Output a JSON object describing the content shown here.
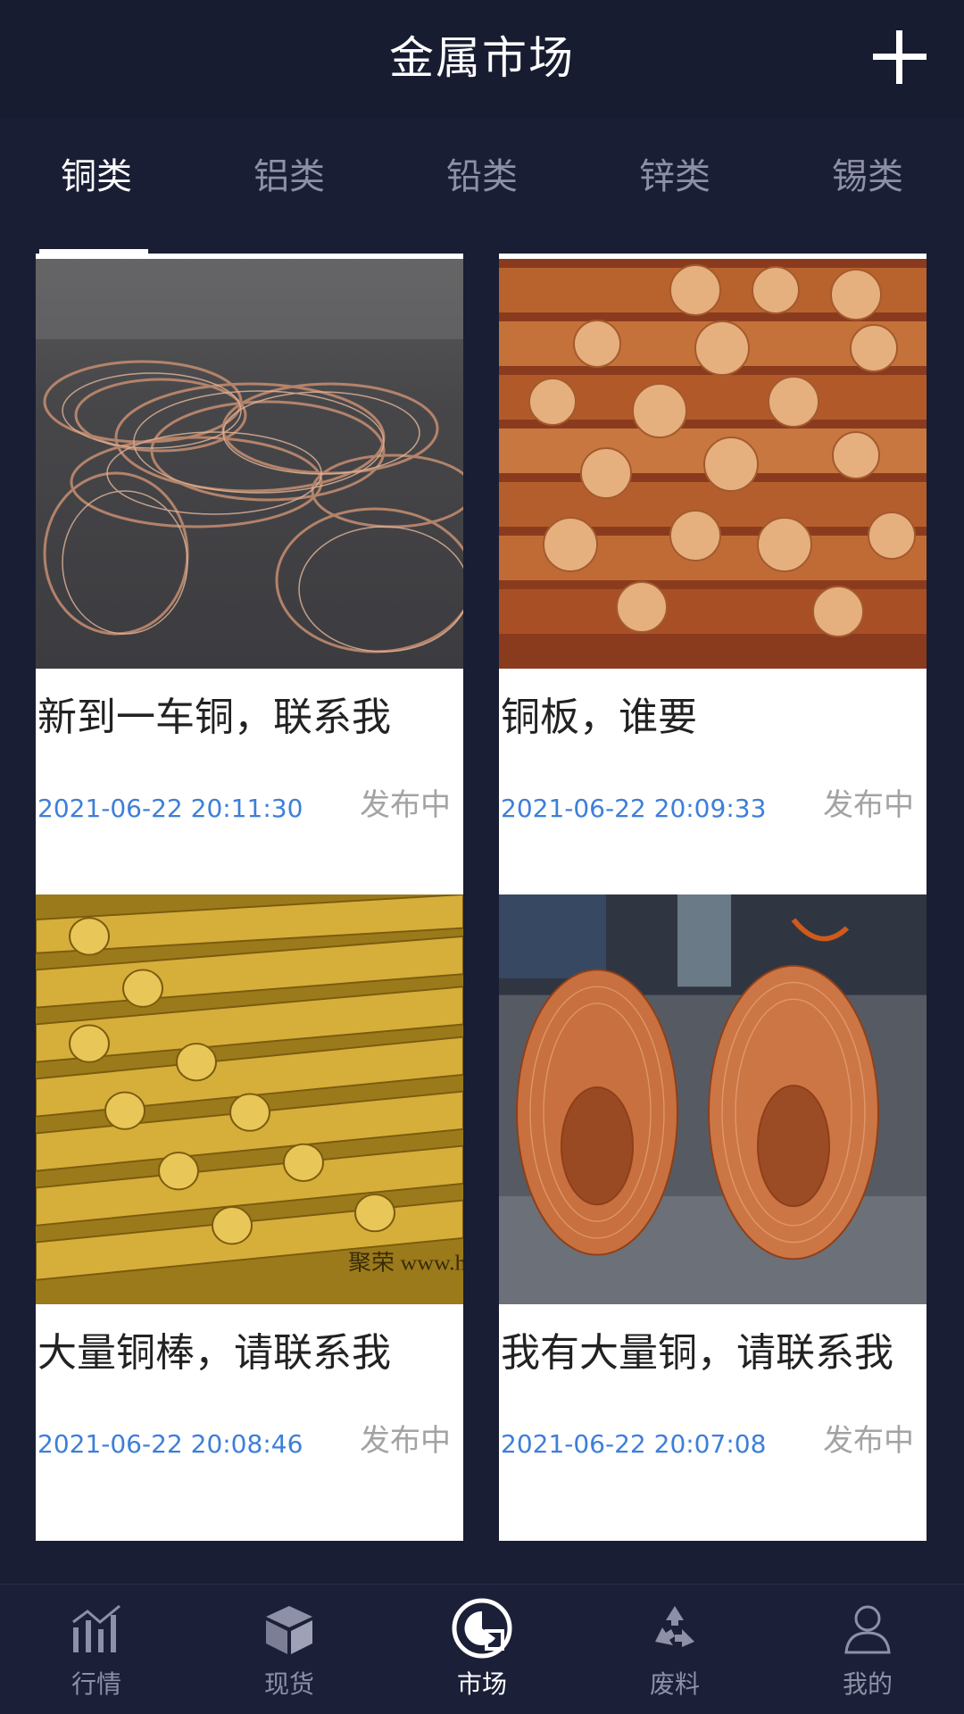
{
  "header": {
    "title": "金属市场",
    "add_icon": "plus-icon"
  },
  "tabs": [
    {
      "label": "铜类",
      "active": true
    },
    {
      "label": "铝类",
      "active": false
    },
    {
      "label": "铅类",
      "active": false
    },
    {
      "label": "锌类",
      "active": false
    },
    {
      "label": "锡类",
      "active": false
    }
  ],
  "cards": [
    {
      "title": "新到一车铜，联系我",
      "time": "2021-06-22 20:11:30",
      "status": "发布中",
      "image": "copper-wire-scrap-photo"
    },
    {
      "title": "铜板，谁要",
      "time": "2021-06-22 20:09:33",
      "status": "发布中",
      "image": "copper-rods-photo"
    },
    {
      "title": "大量铜棒，请联系我",
      "time": "2021-06-22 20:08:46",
      "status": "发布中",
      "image": "brass-bars-photo",
      "watermark": "聚荣 www.hua"
    },
    {
      "title": "我有大量铜，请联系我",
      "time": "2021-06-22 20:07:08",
      "status": "发布中",
      "image": "copper-coils-photo"
    }
  ],
  "bottom_nav": [
    {
      "label": "行情",
      "icon": "chart-icon",
      "active": false
    },
    {
      "label": "现货",
      "icon": "box-icon",
      "active": false
    },
    {
      "label": "市场",
      "icon": "market-icon",
      "active": true
    },
    {
      "label": "废料",
      "icon": "recycle-icon",
      "active": false
    },
    {
      "label": "我的",
      "icon": "user-icon",
      "active": false
    }
  ],
  "colors": {
    "background": "#1a1e34",
    "time_text": "#3d7fd9",
    "status_text": "#a3a3a3",
    "inactive_text": "#8d90a6"
  }
}
